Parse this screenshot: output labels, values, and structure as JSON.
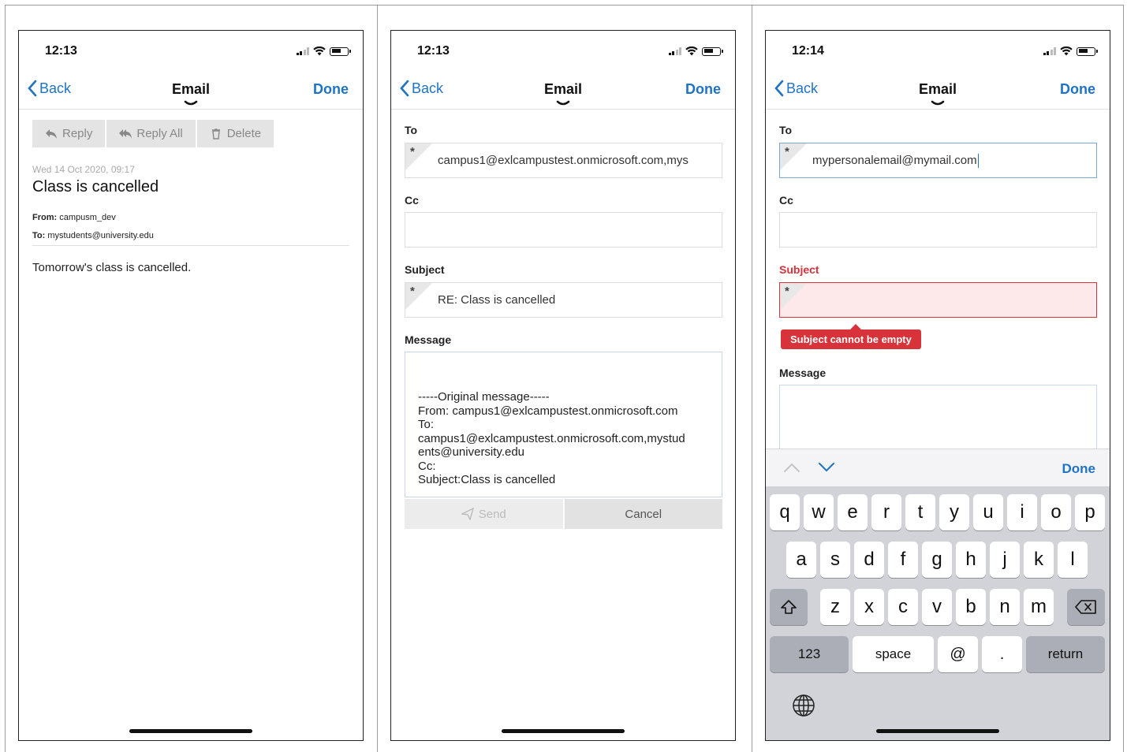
{
  "common": {
    "back_label": "Back",
    "nav_title": "Email",
    "done_label": "Done"
  },
  "panel1": {
    "time": "12:13",
    "actions": {
      "reply": "Reply",
      "reply_all": "Reply All",
      "delete": "Delete"
    },
    "date": "Wed 14 Oct 2020, 09:17",
    "subject": "Class is cancelled",
    "from_label": "From:",
    "from_value": "campusm_dev",
    "to_label": "To:",
    "to_value": "mystudents@university.edu",
    "body": "Tomorrow's class is cancelled."
  },
  "panel2": {
    "time": "12:13",
    "to_label": "To",
    "to_value": "campus1@exlcampustest.onmicrosoft.com,mys",
    "cc_label": "Cc",
    "cc_value": "",
    "subject_label": "Subject",
    "subject_value": "RE: Class is cancelled",
    "message_label": "Message",
    "message_lines": [
      "-----Original message-----",
      "From: campus1@exlcampustest.onmicrosoft.com",
      "To:",
      "campus1@exlcampustest.onmicrosoft.com,mystud",
      "ents@university.edu",
      "Cc:",
      "Subject:Class is cancelled"
    ],
    "send_label": "Send",
    "cancel_label": "Cancel"
  },
  "panel3": {
    "time": "12:14",
    "to_label": "To",
    "to_value": "mypersonalemail@mymail.com",
    "cc_label": "Cc",
    "subject_label": "Subject",
    "subject_error": "Subject cannot be empty",
    "message_label": "Message",
    "kb_done": "Done",
    "keys_row1": [
      "q",
      "w",
      "e",
      "r",
      "t",
      "y",
      "u",
      "i",
      "o",
      "p"
    ],
    "keys_row2": [
      "a",
      "s",
      "d",
      "f",
      "g",
      "h",
      "j",
      "k",
      "l"
    ],
    "keys_row3": [
      "z",
      "x",
      "c",
      "v",
      "b",
      "n",
      "m"
    ],
    "key_123": "123",
    "key_space": "space",
    "key_at": "@",
    "key_dot": ".",
    "key_return": "return"
  },
  "colors": {
    "accent": "#1f73c4",
    "error": "#d8323a"
  }
}
